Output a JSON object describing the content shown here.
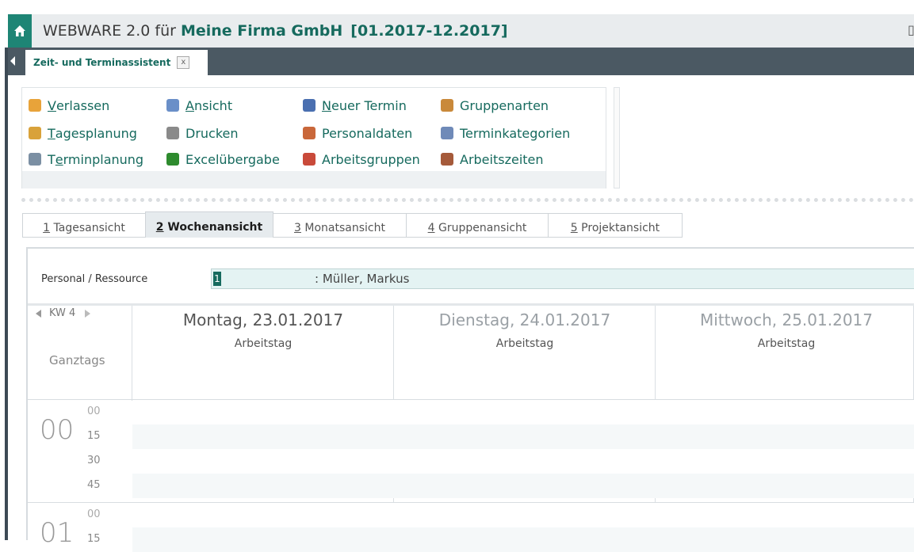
{
  "window": {
    "app_name": "WEBWARE 2.0 für",
    "company": "Meine Firma GmbH",
    "period": "[01.2017-12.2017]"
  },
  "doc_tab": {
    "label": "Zeit- und Terminassistent",
    "close": "x"
  },
  "toolbar": {
    "columns": [
      [
        {
          "pre": "",
          "ul": "V",
          "post": "erlassen",
          "icon": "exit-icon",
          "color": "#e8a33a"
        },
        {
          "pre": "",
          "ul": "T",
          "post": "agesplanung",
          "icon": "day-planning-icon",
          "color": "#d9a23a"
        },
        {
          "pre": "T",
          "ul": "e",
          "post": "rminplanung",
          "icon": "appointment-planning-icon",
          "color": "#7b8fa3"
        }
      ],
      [
        {
          "pre": "",
          "ul": "A",
          "post": "nsicht",
          "icon": "preview-icon",
          "color": "#6a8fc8"
        },
        {
          "pre": "",
          "ul": "",
          "post": "Drucken",
          "icon": "print-icon",
          "color": "#8a8a8a"
        },
        {
          "pre": "",
          "ul": "",
          "post": "Excelübergabe",
          "icon": "excel-icon",
          "color": "#2e8b2e"
        }
      ],
      [
        {
          "pre": "",
          "ul": "N",
          "post": "euer Termin",
          "icon": "calendar-icon",
          "color": "#4a6fb0"
        },
        {
          "pre": "",
          "ul": "",
          "post": "Personaldaten",
          "icon": "persons-icon",
          "color": "#c9673a"
        },
        {
          "pre": "",
          "ul": "",
          "post": "Arbeitsgruppen",
          "icon": "workgroups-icon",
          "color": "#c94a3a"
        }
      ],
      [
        {
          "pre": "",
          "ul": "",
          "post": "Gruppenarten",
          "icon": "group-types-icon",
          "color": "#c9893a"
        },
        {
          "pre": "",
          "ul": "",
          "post": "Terminkategorien",
          "icon": "categories-icon",
          "color": "#6f8ab8"
        },
        {
          "pre": "",
          "ul": "",
          "post": "Arbeitszeiten",
          "icon": "working-hours-icon",
          "color": "#a55a3a"
        }
      ]
    ]
  },
  "view_tabs": [
    {
      "key": "1",
      "label": " Tagesansicht",
      "active": false
    },
    {
      "key": "2",
      "label": " Wochenansicht",
      "active": true
    },
    {
      "key": "3",
      "label": " Monatsansicht",
      "active": false
    },
    {
      "key": "4",
      "label": " Gruppenansicht",
      "active": false
    },
    {
      "key": "5",
      "label": " Projektansicht",
      "active": false
    }
  ],
  "resource": {
    "label": "Personal / Ressource",
    "number": "1",
    "name": ": Müller, Markus"
  },
  "calendar": {
    "week": "KW 4",
    "allday_label": "Ganztags",
    "days": [
      {
        "title": "Montag, 23.01.2017",
        "type": "Arbeitstag",
        "color": "#555555"
      },
      {
        "title": "Dienstag, 24.01.2017",
        "type": "Arbeitstag",
        "color": "#9aa0a5"
      },
      {
        "title": "Mittwoch, 25.01.2017",
        "type": "Arbeitstag",
        "color": "#9aa0a5"
      }
    ],
    "hours": [
      {
        "hour": "00",
        "minutes": [
          "00",
          "15",
          "30",
          "45"
        ]
      },
      {
        "hour": "01",
        "minutes": [
          "00",
          "15"
        ]
      }
    ]
  }
}
